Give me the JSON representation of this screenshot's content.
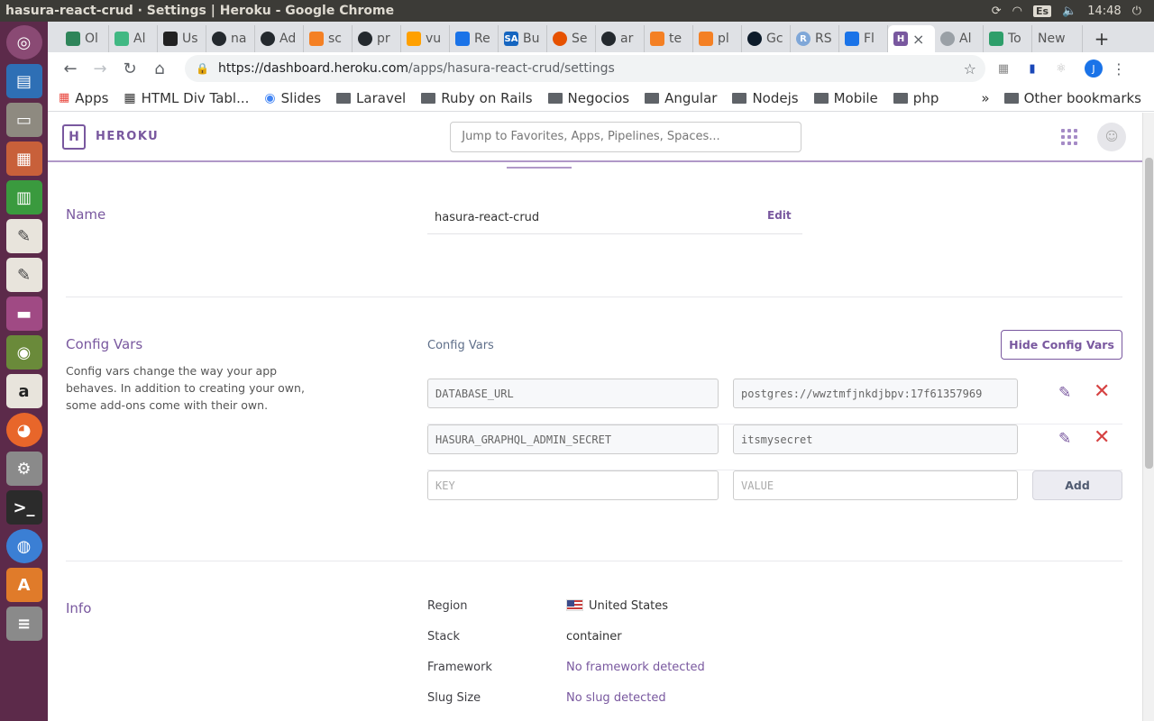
{
  "os": {
    "window_title": "hasura-react-crud · Settings | Heroku - Google Chrome",
    "keyboard_layout": "Es",
    "clock": "14:48"
  },
  "launcher": {
    "items": [
      "ubuntu",
      "writer-document",
      "file-manager",
      "impress",
      "calc",
      "text-editor",
      "text-editor-2",
      "workspace",
      "image-viewer",
      "amazon",
      "firefox",
      "settings",
      "terminal",
      "chrome",
      "software-center",
      "more"
    ]
  },
  "tabs": [
    {
      "label": "Ol",
      "color": "#2f855a"
    },
    {
      "label": "Al",
      "color": "#41b883"
    },
    {
      "label": "Us",
      "color": "#222222"
    },
    {
      "label": "na",
      "color": "#24292e"
    },
    {
      "label": "Ad",
      "color": "#24292e"
    },
    {
      "label": "sc",
      "color": "#f48024"
    },
    {
      "label": "pr",
      "color": "#24292e"
    },
    {
      "label": "vu",
      "color": "#ffa000"
    },
    {
      "label": "Re",
      "color": "#1a73e8"
    },
    {
      "label": "Bu",
      "color": "#1565c0"
    },
    {
      "label": "Se",
      "color": "#e65100"
    },
    {
      "label": "ar",
      "color": "#24292e"
    },
    {
      "label": "te",
      "color": "#f48024"
    },
    {
      "label": "pl",
      "color": "#f48024"
    },
    {
      "label": "Gc",
      "color": "#0d1b2a"
    },
    {
      "label": "RS",
      "color": "#7fa7d8"
    },
    {
      "label": "Fl",
      "color": "#1a73e8"
    },
    {
      "label": "",
      "color": "#79589f",
      "active": true
    },
    {
      "label": "Al",
      "color": "#9aa0a6"
    },
    {
      "label": "To",
      "color": "#2e9e6a"
    },
    {
      "label": "New",
      "color": ""
    }
  ],
  "close_tab": "×",
  "new_tab": "+",
  "address": {
    "host": "https://dashboard.heroku.com",
    "path": "/apps/hasura-react-crud/settings"
  },
  "profile_initial": "J",
  "bookmarks": {
    "apps_label": "Apps",
    "items": [
      "HTML Div Tabl...",
      "Slides",
      "Laravel",
      "Ruby on Rails",
      "Negocios",
      "Angular",
      "Nodejs",
      "Mobile",
      "php"
    ],
    "overflow": "»",
    "other": "Other bookmarks"
  },
  "heroku": {
    "logo_letter": "H",
    "brand": "HEROKU",
    "search_placeholder": "Jump to Favorites, Apps, Pipelines, Spaces..."
  },
  "name_section": {
    "title": "Name",
    "value": "hasura-react-crud",
    "edit_label": "Edit"
  },
  "config_section": {
    "title": "Config Vars",
    "description": "Config vars change the way your app behaves. In addition to creating your own, some add-ons come with their own.",
    "subtitle": "Config Vars",
    "hide_button": "Hide Config Vars",
    "vars": [
      {
        "key": "DATABASE_URL",
        "value": "postgres://wwztmfjnkdjbpv:17f61357969"
      },
      {
        "key": "HASURA_GRAPHQL_ADMIN_SECRET",
        "value": "itsmysecret"
      }
    ],
    "key_placeholder": "KEY",
    "value_placeholder": "VALUE",
    "add_button": "Add"
  },
  "info_section": {
    "title": "Info",
    "rows": [
      {
        "label": "Region",
        "value": "United States"
      },
      {
        "label": "Stack",
        "value": "container"
      },
      {
        "label": "Framework",
        "value": "No framework detected"
      },
      {
        "label": "Slug Size",
        "value": "No slug detected"
      }
    ]
  }
}
